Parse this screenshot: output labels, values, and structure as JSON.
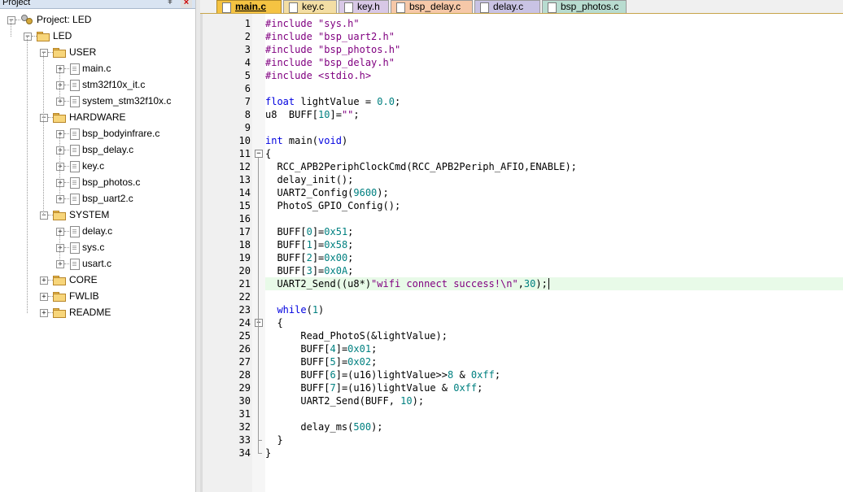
{
  "project_panel": {
    "title": "Project",
    "pin_glyph": "ǂ",
    "close_glyph": "×",
    "tree": [
      {
        "label": "Project: LED",
        "kind": "project",
        "level": 0,
        "expander": "−"
      },
      {
        "label": "LED",
        "kind": "target",
        "level": 1,
        "expander": "−"
      },
      {
        "label": "USER",
        "kind": "folder",
        "level": 2,
        "expander": "−"
      },
      {
        "label": "main.c",
        "kind": "file",
        "level": 3,
        "expander": "+"
      },
      {
        "label": "stm32f10x_it.c",
        "kind": "file",
        "level": 3,
        "expander": "+"
      },
      {
        "label": "system_stm32f10x.c",
        "kind": "file",
        "level": 3,
        "expander": "+"
      },
      {
        "label": "HARDWARE",
        "kind": "folder",
        "level": 2,
        "expander": "−"
      },
      {
        "label": "bsp_bodyinfrare.c",
        "kind": "file",
        "level": 3,
        "expander": "+"
      },
      {
        "label": "bsp_delay.c",
        "kind": "file",
        "level": 3,
        "expander": "+"
      },
      {
        "label": "key.c",
        "kind": "file",
        "level": 3,
        "expander": "+"
      },
      {
        "label": "bsp_photos.c",
        "kind": "file",
        "level": 3,
        "expander": "+"
      },
      {
        "label": "bsp_uart2.c",
        "kind": "file",
        "level": 3,
        "expander": "+"
      },
      {
        "label": "SYSTEM",
        "kind": "folder",
        "level": 2,
        "expander": "−"
      },
      {
        "label": "delay.c",
        "kind": "file",
        "level": 3,
        "expander": "+"
      },
      {
        "label": "sys.c",
        "kind": "file",
        "level": 3,
        "expander": "+"
      },
      {
        "label": "usart.c",
        "kind": "file",
        "level": 3,
        "expander": "+"
      },
      {
        "label": "CORE",
        "kind": "folder",
        "level": 2,
        "expander": "+"
      },
      {
        "label": "FWLIB",
        "kind": "folder",
        "level": 2,
        "expander": "+"
      },
      {
        "label": "README",
        "kind": "folder",
        "level": 2,
        "expander": "+"
      }
    ]
  },
  "tabs": [
    {
      "label": "main.c",
      "color": "#f5c342",
      "active": true
    },
    {
      "label": "key.c",
      "color": "#f3dea4",
      "active": false
    },
    {
      "label": "key.h",
      "color": "#d8c8e6",
      "active": false
    },
    {
      "label": "bsp_delay.c",
      "color": "#f6c8a8",
      "active": false
    },
    {
      "label": "delay.c",
      "color": "#c9c3e4",
      "active": false
    },
    {
      "label": "bsp_photos.c",
      "color": "#b8dcd0",
      "active": false
    }
  ],
  "editor": {
    "highlight_line": 21,
    "lines": [
      "#include \"sys.h\"",
      "#include \"bsp_uart2.h\"",
      "#include \"bsp_photos.h\"",
      "#include \"bsp_delay.h\"",
      "#include <stdio.h>",
      "",
      "float lightValue = 0.0;",
      "u8  BUFF[10]=\"\";",
      "",
      "int main(void)",
      "{",
      "  RCC_APB2PeriphClockCmd(RCC_APB2Periph_AFIO,ENABLE);",
      "  delay_init();",
      "  UART2_Config(9600);",
      "  PhotoS_GPIO_Config();",
      "",
      "  BUFF[0]=0x51;",
      "  BUFF[1]=0x58;",
      "  BUFF[2]=0x00;",
      "  BUFF[3]=0x0A;",
      "  UART2_Send((u8*)\"wifi connect success!\\n\",30);",
      "",
      "  while(1)",
      "  {",
      "      Read_PhotoS(&lightValue);",
      "      BUFF[4]=0x01;",
      "      BUFF[5]=0x02;",
      "      BUFF[6]=(u16)lightValue>>8 & 0xff;",
      "      BUFF[7]=(u16)lightValue & 0xff;",
      "      UART2_Send(BUFF, 10);",
      "",
      "      delay_ms(500);",
      "  }",
      "}"
    ],
    "fold_markers": [
      {
        "line": 11,
        "glyph": "−"
      },
      {
        "line": 24,
        "glyph": "−"
      }
    ]
  }
}
